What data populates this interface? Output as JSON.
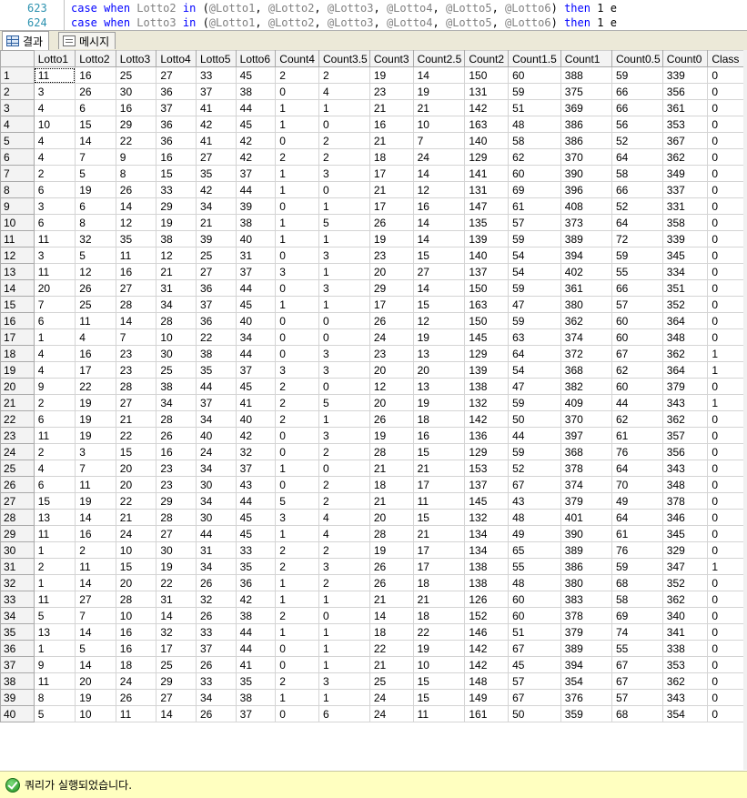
{
  "code": {
    "lines": [
      {
        "number": "623",
        "text": "case when Lotto2 in (@Lotto1, @Lotto2, @Lotto3, @Lotto4, @Lotto5, @Lotto6) then 1 e"
      },
      {
        "number": "624",
        "text": "case when Lotto3 in (@Lotto1, @Lotto2, @Lotto3, @Lotto4, @Lotto5, @Lotto6) then 1 e"
      }
    ]
  },
  "tabs": [
    {
      "label": "결과",
      "icon": "grid-icon",
      "active": true
    },
    {
      "label": "메시지",
      "icon": "message-icon",
      "active": false
    }
  ],
  "grid": {
    "columns": [
      "Lotto1",
      "Lotto2",
      "Lotto3",
      "Lotto4",
      "Lotto5",
      "Lotto6",
      "Count4",
      "Count3.5",
      "Count3",
      "Count2.5",
      "Count2",
      "Count1.5",
      "Count1",
      "Count0.5",
      "Count0",
      "Class"
    ],
    "rows": [
      [
        "1",
        [
          "11",
          "16",
          "25",
          "27",
          "33",
          "45",
          "2",
          "2",
          "19",
          "14",
          "150",
          "60",
          "388",
          "59",
          "339",
          "0"
        ]
      ],
      [
        "2",
        [
          "3",
          "26",
          "30",
          "36",
          "37",
          "38",
          "0",
          "4",
          "23",
          "19",
          "131",
          "59",
          "375",
          "66",
          "356",
          "0"
        ]
      ],
      [
        "3",
        [
          "4",
          "6",
          "16",
          "37",
          "41",
          "44",
          "1",
          "1",
          "21",
          "21",
          "142",
          "51",
          "369",
          "66",
          "361",
          "0"
        ]
      ],
      [
        "4",
        [
          "10",
          "15",
          "29",
          "36",
          "42",
          "45",
          "1",
          "0",
          "16",
          "10",
          "163",
          "48",
          "386",
          "56",
          "353",
          "0"
        ]
      ],
      [
        "5",
        [
          "4",
          "14",
          "22",
          "36",
          "41",
          "42",
          "0",
          "2",
          "21",
          "7",
          "140",
          "58",
          "386",
          "52",
          "367",
          "0"
        ]
      ],
      [
        "6",
        [
          "4",
          "7",
          "9",
          "16",
          "27",
          "42",
          "2",
          "2",
          "18",
          "24",
          "129",
          "62",
          "370",
          "64",
          "362",
          "0"
        ]
      ],
      [
        "7",
        [
          "2",
          "5",
          "8",
          "15",
          "35",
          "37",
          "1",
          "3",
          "17",
          "14",
          "141",
          "60",
          "390",
          "58",
          "349",
          "0"
        ]
      ],
      [
        "8",
        [
          "6",
          "19",
          "26",
          "33",
          "42",
          "44",
          "1",
          "0",
          "21",
          "12",
          "131",
          "69",
          "396",
          "66",
          "337",
          "0"
        ]
      ],
      [
        "9",
        [
          "3",
          "6",
          "14",
          "29",
          "34",
          "39",
          "0",
          "1",
          "17",
          "16",
          "147",
          "61",
          "408",
          "52",
          "331",
          "0"
        ]
      ],
      [
        "10",
        [
          "6",
          "8",
          "12",
          "19",
          "21",
          "38",
          "1",
          "5",
          "26",
          "14",
          "135",
          "57",
          "373",
          "64",
          "358",
          "0"
        ]
      ],
      [
        "11",
        [
          "11",
          "32",
          "35",
          "38",
          "39",
          "40",
          "1",
          "1",
          "19",
          "14",
          "139",
          "59",
          "389",
          "72",
          "339",
          "0"
        ]
      ],
      [
        "12",
        [
          "3",
          "5",
          "11",
          "12",
          "25",
          "31",
          "0",
          "3",
          "23",
          "15",
          "140",
          "54",
          "394",
          "59",
          "345",
          "0"
        ]
      ],
      [
        "13",
        [
          "11",
          "12",
          "16",
          "21",
          "27",
          "37",
          "3",
          "1",
          "20",
          "27",
          "137",
          "54",
          "402",
          "55",
          "334",
          "0"
        ]
      ],
      [
        "14",
        [
          "20",
          "26",
          "27",
          "31",
          "36",
          "44",
          "0",
          "3",
          "29",
          "14",
          "150",
          "59",
          "361",
          "66",
          "351",
          "0"
        ]
      ],
      [
        "15",
        [
          "7",
          "25",
          "28",
          "34",
          "37",
          "45",
          "1",
          "1",
          "17",
          "15",
          "163",
          "47",
          "380",
          "57",
          "352",
          "0"
        ]
      ],
      [
        "16",
        [
          "6",
          "11",
          "14",
          "28",
          "36",
          "40",
          "0",
          "0",
          "26",
          "12",
          "150",
          "59",
          "362",
          "60",
          "364",
          "0"
        ]
      ],
      [
        "17",
        [
          "1",
          "4",
          "7",
          "10",
          "22",
          "34",
          "0",
          "0",
          "24",
          "19",
          "145",
          "63",
          "374",
          "60",
          "348",
          "0"
        ]
      ],
      [
        "18",
        [
          "4",
          "16",
          "23",
          "30",
          "38",
          "44",
          "0",
          "3",
          "23",
          "13",
          "129",
          "64",
          "372",
          "67",
          "362",
          "1"
        ]
      ],
      [
        "19",
        [
          "4",
          "17",
          "23",
          "25",
          "35",
          "37",
          "3",
          "3",
          "20",
          "20",
          "139",
          "54",
          "368",
          "62",
          "364",
          "1"
        ]
      ],
      [
        "20",
        [
          "9",
          "22",
          "28",
          "38",
          "44",
          "45",
          "2",
          "0",
          "12",
          "13",
          "138",
          "47",
          "382",
          "60",
          "379",
          "0"
        ]
      ],
      [
        "21",
        [
          "2",
          "19",
          "27",
          "34",
          "37",
          "41",
          "2",
          "5",
          "20",
          "19",
          "132",
          "59",
          "409",
          "44",
          "343",
          "1"
        ]
      ],
      [
        "22",
        [
          "6",
          "19",
          "21",
          "28",
          "34",
          "40",
          "2",
          "1",
          "26",
          "18",
          "142",
          "50",
          "370",
          "62",
          "362",
          "0"
        ]
      ],
      [
        "23",
        [
          "11",
          "19",
          "22",
          "26",
          "40",
          "42",
          "0",
          "3",
          "19",
          "16",
          "136",
          "44",
          "397",
          "61",
          "357",
          "0"
        ]
      ],
      [
        "24",
        [
          "2",
          "3",
          "15",
          "16",
          "24",
          "32",
          "0",
          "2",
          "28",
          "15",
          "129",
          "59",
          "368",
          "76",
          "356",
          "0"
        ]
      ],
      [
        "25",
        [
          "4",
          "7",
          "20",
          "23",
          "34",
          "37",
          "1",
          "0",
          "21",
          "21",
          "153",
          "52",
          "378",
          "64",
          "343",
          "0"
        ]
      ],
      [
        "26",
        [
          "6",
          "11",
          "20",
          "23",
          "30",
          "43",
          "0",
          "2",
          "18",
          "17",
          "137",
          "67",
          "374",
          "70",
          "348",
          "0"
        ]
      ],
      [
        "27",
        [
          "15",
          "19",
          "22",
          "29",
          "34",
          "44",
          "5",
          "2",
          "21",
          "11",
          "145",
          "43",
          "379",
          "49",
          "378",
          "0"
        ]
      ],
      [
        "28",
        [
          "13",
          "14",
          "21",
          "28",
          "30",
          "45",
          "3",
          "4",
          "20",
          "15",
          "132",
          "48",
          "401",
          "64",
          "346",
          "0"
        ]
      ],
      [
        "29",
        [
          "11",
          "16",
          "24",
          "27",
          "44",
          "45",
          "1",
          "4",
          "28",
          "21",
          "134",
          "49",
          "390",
          "61",
          "345",
          "0"
        ]
      ],
      [
        "30",
        [
          "1",
          "2",
          "10",
          "30",
          "31",
          "33",
          "2",
          "2",
          "19",
          "17",
          "134",
          "65",
          "389",
          "76",
          "329",
          "0"
        ]
      ],
      [
        "31",
        [
          "2",
          "11",
          "15",
          "19",
          "34",
          "35",
          "2",
          "3",
          "26",
          "17",
          "138",
          "55",
          "386",
          "59",
          "347",
          "1"
        ]
      ],
      [
        "32",
        [
          "1",
          "14",
          "20",
          "22",
          "26",
          "36",
          "1",
          "2",
          "26",
          "18",
          "138",
          "48",
          "380",
          "68",
          "352",
          "0"
        ]
      ],
      [
        "33",
        [
          "11",
          "27",
          "28",
          "31",
          "32",
          "42",
          "1",
          "1",
          "21",
          "21",
          "126",
          "60",
          "383",
          "58",
          "362",
          "0"
        ]
      ],
      [
        "34",
        [
          "5",
          "7",
          "10",
          "14",
          "26",
          "38",
          "2",
          "0",
          "14",
          "18",
          "152",
          "60",
          "378",
          "69",
          "340",
          "0"
        ]
      ],
      [
        "35",
        [
          "13",
          "14",
          "16",
          "32",
          "33",
          "44",
          "1",
          "1",
          "18",
          "22",
          "146",
          "51",
          "379",
          "74",
          "341",
          "0"
        ]
      ],
      [
        "36",
        [
          "1",
          "5",
          "16",
          "17",
          "37",
          "44",
          "0",
          "1",
          "22",
          "19",
          "142",
          "67",
          "389",
          "55",
          "338",
          "0"
        ]
      ],
      [
        "37",
        [
          "9",
          "14",
          "18",
          "25",
          "26",
          "41",
          "0",
          "1",
          "21",
          "10",
          "142",
          "45",
          "394",
          "67",
          "353",
          "0"
        ]
      ],
      [
        "38",
        [
          "11",
          "20",
          "24",
          "29",
          "33",
          "35",
          "2",
          "3",
          "25",
          "15",
          "148",
          "57",
          "354",
          "67",
          "362",
          "0"
        ]
      ],
      [
        "39",
        [
          "8",
          "19",
          "26",
          "27",
          "34",
          "38",
          "1",
          "1",
          "24",
          "15",
          "149",
          "67",
          "376",
          "57",
          "343",
          "0"
        ]
      ],
      [
        "40",
        [
          "5",
          "10",
          "11",
          "14",
          "26",
          "37",
          "0",
          "6",
          "24",
          "11",
          "161",
          "50",
          "359",
          "68",
          "354",
          "0"
        ]
      ]
    ]
  },
  "status": {
    "icon": "check-circle-icon",
    "text": "쿼리가 실행되었습니다."
  }
}
